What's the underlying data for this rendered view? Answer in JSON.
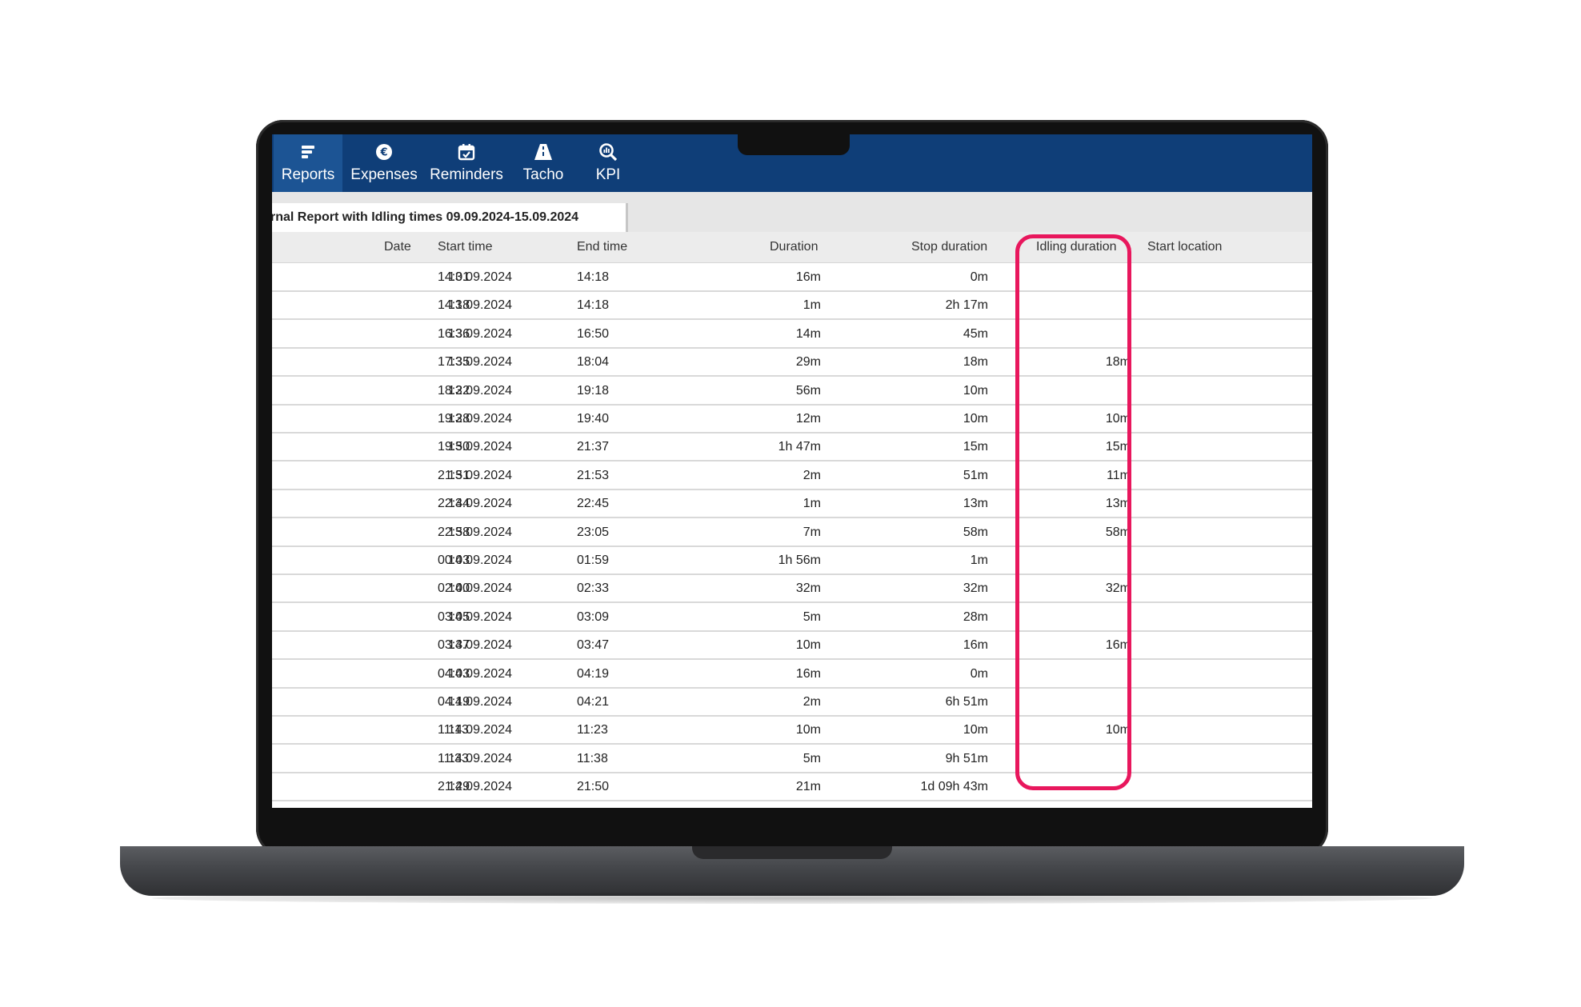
{
  "nav": {
    "items": [
      {
        "label": "Reports",
        "icon": "reports-icon"
      },
      {
        "label": "Expenses",
        "icon": "euro-coin-icon"
      },
      {
        "label": "Reminders",
        "icon": "calendar-check-icon"
      },
      {
        "label": "Tacho",
        "icon": "road-icon"
      },
      {
        "label": "KPI",
        "icon": "magnifier-chart-icon"
      }
    ]
  },
  "tab": {
    "title": "rnal Report with Idling times 09.09.2024-15.09.2024"
  },
  "table": {
    "columns": [
      "Date",
      "Start time",
      "End time",
      "Duration",
      "Stop duration",
      "Idling duration",
      "Start location"
    ],
    "rows": [
      {
        "date": "13.09.2024",
        "start": "14:01",
        "end": "14:18",
        "duration": "16m",
        "stop": "0m",
        "idling": ""
      },
      {
        "date": "13.09.2024",
        "start": "14:18",
        "end": "14:18",
        "duration": "1m",
        "stop": "2h 17m",
        "idling": ""
      },
      {
        "date": "13.09.2024",
        "start": "16:36",
        "end": "16:50",
        "duration": "14m",
        "stop": "45m",
        "idling": ""
      },
      {
        "date": "13.09.2024",
        "start": "17:35",
        "end": "18:04",
        "duration": "29m",
        "stop": "18m",
        "idling": "18m"
      },
      {
        "date": "13.09.2024",
        "start": "18:22",
        "end": "19:18",
        "duration": "56m",
        "stop": "10m",
        "idling": ""
      },
      {
        "date": "13.09.2024",
        "start": "19:28",
        "end": "19:40",
        "duration": "12m",
        "stop": "10m",
        "idling": "10m"
      },
      {
        "date": "13.09.2024",
        "start": "19:50",
        "end": "21:37",
        "duration": "1h 47m",
        "stop": "15m",
        "idling": "15m"
      },
      {
        "date": "13.09.2024",
        "start": "21:51",
        "end": "21:53",
        "duration": "2m",
        "stop": "51m",
        "idling": "11m"
      },
      {
        "date": "13.09.2024",
        "start": "22:44",
        "end": "22:45",
        "duration": "1m",
        "stop": "13m",
        "idling": "13m"
      },
      {
        "date": "13.09.2024",
        "start": "22:58",
        "end": "23:05",
        "duration": "7m",
        "stop": "58m",
        "idling": "58m"
      },
      {
        "date": "14.09.2024",
        "start": "00:03",
        "end": "01:59",
        "duration": "1h 56m",
        "stop": "1m",
        "idling": ""
      },
      {
        "date": "14.09.2024",
        "start": "02:00",
        "end": "02:33",
        "duration": "32m",
        "stop": "32m",
        "idling": "32m"
      },
      {
        "date": "14.09.2024",
        "start": "03:05",
        "end": "03:09",
        "duration": "5m",
        "stop": "28m",
        "idling": ""
      },
      {
        "date": "14.09.2024",
        "start": "03:37",
        "end": "03:47",
        "duration": "10m",
        "stop": "16m",
        "idling": "16m"
      },
      {
        "date": "14.09.2024",
        "start": "04:03",
        "end": "04:19",
        "duration": "16m",
        "stop": "0m",
        "idling": ""
      },
      {
        "date": "14.09.2024",
        "start": "04:19",
        "end": "04:21",
        "duration": "2m",
        "stop": "6h 51m",
        "idling": ""
      },
      {
        "date": "14.09.2024",
        "start": "11:13",
        "end": "11:23",
        "duration": "10m",
        "stop": "10m",
        "idling": "10m"
      },
      {
        "date": "14.09.2024",
        "start": "11:33",
        "end": "11:38",
        "duration": "5m",
        "stop": "9h 51m",
        "idling": ""
      },
      {
        "date": "14.09.2024",
        "start": "21:29",
        "end": "21:50",
        "duration": "21m",
        "stop": "1d 09h 43m",
        "idling": ""
      }
    ]
  },
  "colors": {
    "toolbar": "#0f3e78",
    "toolbar_active": "#1c5494",
    "highlight": "#e8175d"
  }
}
